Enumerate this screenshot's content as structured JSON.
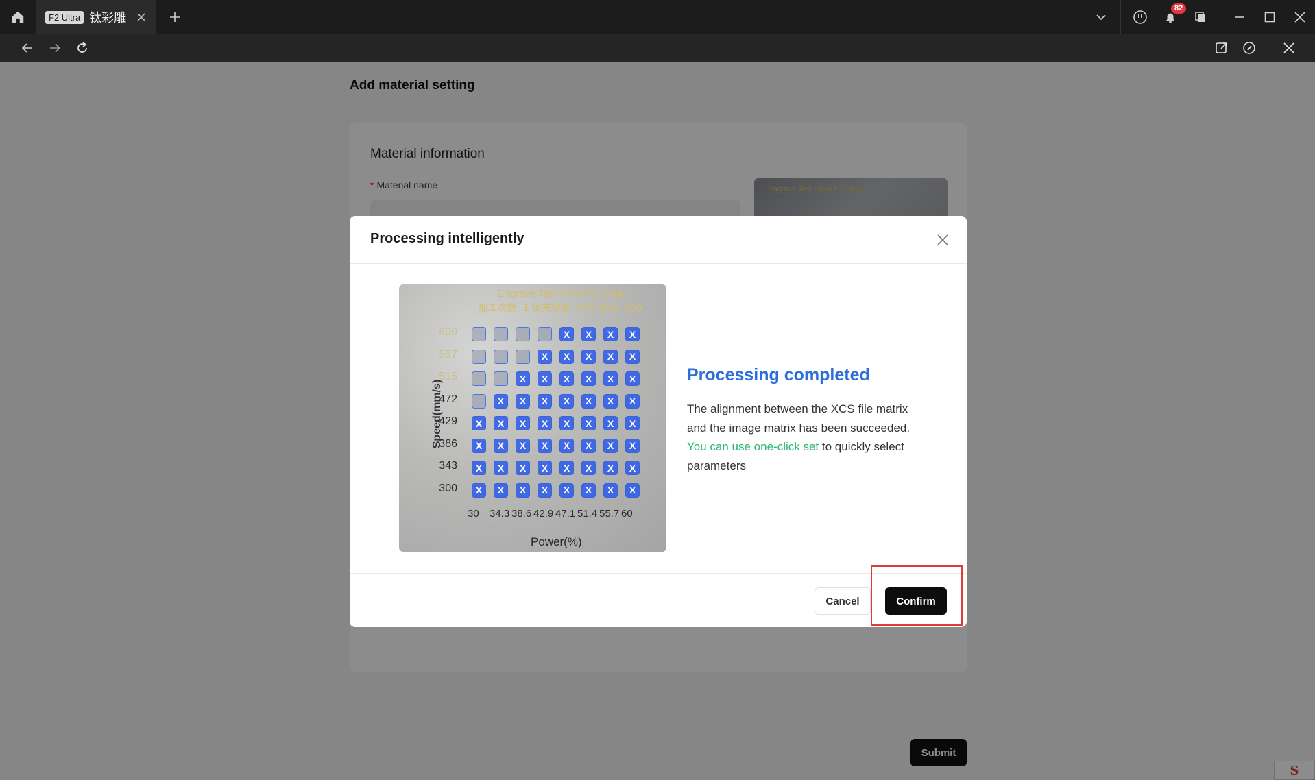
{
  "titlebar": {
    "tab": {
      "badge": "F2 Ultra",
      "title": "钛彩雕"
    },
    "notification_count": "82"
  },
  "page": {
    "title": "Add material setting",
    "card_title": "Material information",
    "material_name_label": "Material name",
    "submit_label": "Submit"
  },
  "modal": {
    "title": "Processing intelligently",
    "image": {
      "header_line1": "Engrave Test xTool F2 Ultra",
      "header_line2": "加工次数: 1 填充密度: 500 频率: 500",
      "speed_axis_label": "Speed(mm/s)",
      "power_axis_label": "Power(%)",
      "speed_values": [
        "600",
        "557",
        "515",
        "472",
        "429",
        "386",
        "343",
        "300"
      ],
      "power_values": [
        "30",
        "34.3",
        "38.6",
        "42.9",
        "47.1",
        "51.4",
        "55.7",
        "60"
      ]
    },
    "status_title": "Processing completed",
    "status_text_1": "The alignment between the XCS file matrix and the image matrix has been succeeded. ",
    "status_text_highlight": "You can use one-click set",
    "status_text_2": " to quickly select parameters",
    "cancel_label": "Cancel",
    "confirm_label": "Confirm"
  }
}
